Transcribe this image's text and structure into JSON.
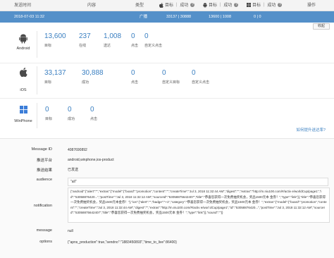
{
  "header": {
    "col_time": "发送时间",
    "col_content": "内容",
    "col_type": "类型",
    "col_ios": "目标 ｜ 成功",
    "col_android": "目标 ｜ 成功",
    "col_winphone": "目标 ｜ 成功",
    "col_action": "操作"
  },
  "row": {
    "time": "2018-07-03 11:32",
    "type": "广播",
    "ios": "33137 | 30888",
    "android": "13600 | 1008",
    "winphone": "0 | 0"
  },
  "collapse_label": "收起",
  "android": {
    "name": "Android",
    "stats": [
      {
        "num": "13,600",
        "label": "目标"
      },
      {
        "num": "237",
        "label": "在线"
      },
      {
        "num": "1,008",
        "label": "送达"
      },
      {
        "num": "0",
        "label": "点击"
      },
      {
        "num": "0",
        "label": "自定义点击"
      }
    ]
  },
  "ios": {
    "name": "iOS",
    "stats": [
      {
        "num": "33,137",
        "label": "目标"
      },
      {
        "num": "30,888",
        "label": "成功"
      },
      {
        "num": "0",
        "label": "点击"
      },
      {
        "num": "0",
        "label": "自定义目标"
      },
      {
        "num": "0",
        "label": "自定义点击"
      }
    ]
  },
  "winphone": {
    "name": "WinPhone",
    "stats": [
      {
        "num": "0",
        "label": "目标"
      },
      {
        "num": "0",
        "label": "成功"
      },
      {
        "num": "0",
        "label": "点击"
      }
    ]
  },
  "help_link": "如何提升送达率?",
  "details": {
    "message_id_label": "Message ID",
    "message_id": "4087690892",
    "platform_label": "推送平台",
    "platform": "android,winphone,ios-product",
    "result_label": "推送结果",
    "result": "已发送",
    "audience_label": "audience",
    "audience": "\"all\"",
    "notification_label": "notification",
    "notification": "{\"android\":{\"alert\":\"\",\"extras\":{\"model\":{\"board\":\"promotion\",\"content\":\"\",\"createTime\":\"Jul 3, 2018 11:32:44 AM\",\"digest\":\"\",\"extras\":\"http://m.niu100.com/#/activ e/worldCup/page1\",\"id\":\"53058876420...\",\"postTime\":\"Jul 3, 2018 11:32:12 AM\",\"sourceId\":\"53058875642407\",\"title\":\"恭喜您获得一次免费抽奖机会，奖品1500元本 金券！\",\"type\":\"link\"}},\"title\":\"恭喜您获得一次免费抽奖机会，奖品1500元本金券！\"},\"ios\":{\"alert\":\"\",\"badge\":\"+1\",\"category\":\"恭喜您获得一次免费抽奖机会，奖品1500元本 金券！\",\"extras\":{\"model\":{\"board\":\"promotion\",\"content\":\"\",\"createTime\":\"Jul 3, 2018 11:32:44 AM\",\"digest\":\"\",\"extras\":\"http://m.niu100.com/#/activ e/worl dCup/page1\",\"id\":\"53058876420...\",\"postTime\":\"Jul 3, 2018 11:32:12 AM\",\"sourceId\":\"53058875642407\",\"title\":\"恭喜您获得一次免费抽奖机会，奖品1500元本 金券！\",\"type\":\"link\"}},\"sound\":\"\"}}",
    "message_label": "message",
    "message": "null",
    "options_label": "options",
    "options": "{\"apns_production\":true,\"sendno\":\"1883450893\",\"time_to_live\":86400}"
  },
  "colors": {
    "accent": "#5490c9",
    "number": "#3a7fc1"
  }
}
